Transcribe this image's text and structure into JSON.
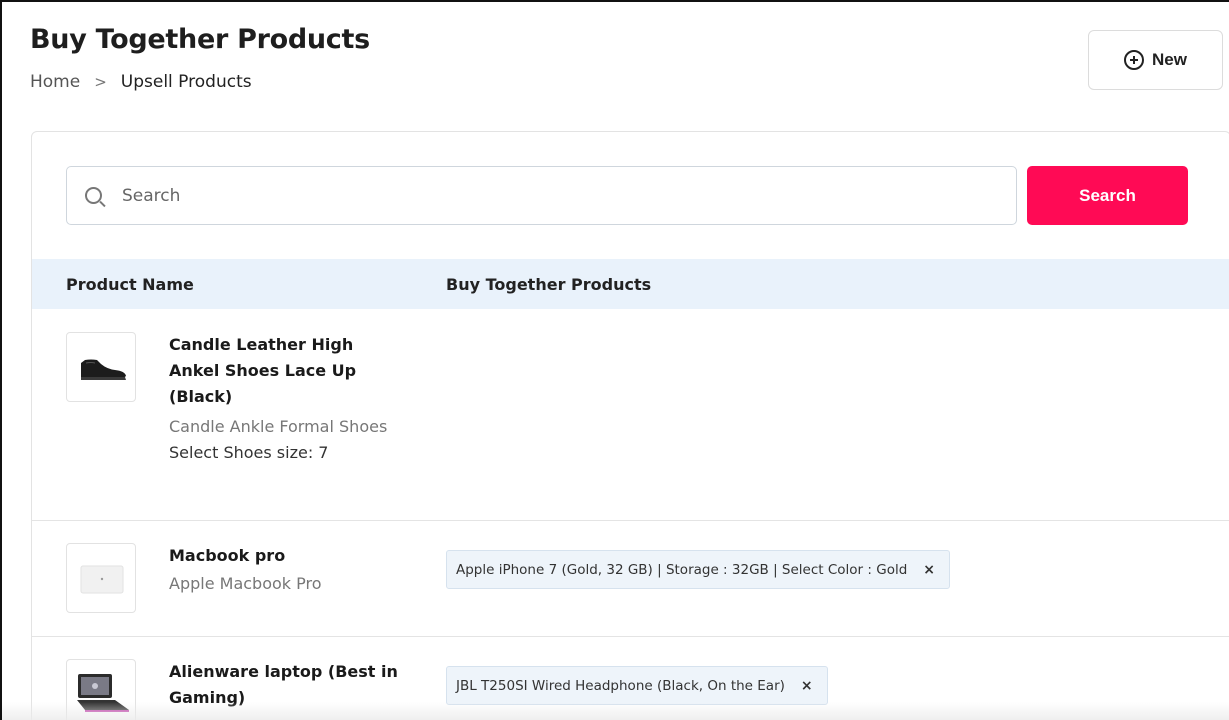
{
  "header": {
    "title": "Buy Together Products",
    "new_button_label": "New"
  },
  "breadcrumb": {
    "home": "Home",
    "separator": ">",
    "current": "Upsell Products"
  },
  "search": {
    "placeholder": "Search",
    "button_label": "Search"
  },
  "colors": {
    "accent": "#ff0a55",
    "table_header_bg": "#e9f2fb"
  },
  "table": {
    "columns": [
      "Product Name",
      "Buy Together Products"
    ],
    "rows": [
      {
        "name": "Candle Leather High Ankel Shoes Lace Up (Black)",
        "subtitle": "Candle Ankle Formal Shoes",
        "variant": "Select Shoes size: 7",
        "image_icon": "black-shoe-image",
        "buy_together": []
      },
      {
        "name": "Macbook pro",
        "subtitle": "Apple Macbook Pro",
        "variant": "",
        "image_icon": "laptop-image",
        "buy_together": [
          "Apple iPhone 7 (Gold, 32 GB) | Storage : 32GB | Select Color : Gold"
        ]
      },
      {
        "name": "Alienware laptop (Best in Gaming)",
        "subtitle": "",
        "variant": "",
        "image_icon": "gaming-laptop-image",
        "buy_together": [
          "JBL T250SI Wired Headphone (Black, On the Ear)"
        ]
      }
    ],
    "remove_symbol": "×"
  }
}
